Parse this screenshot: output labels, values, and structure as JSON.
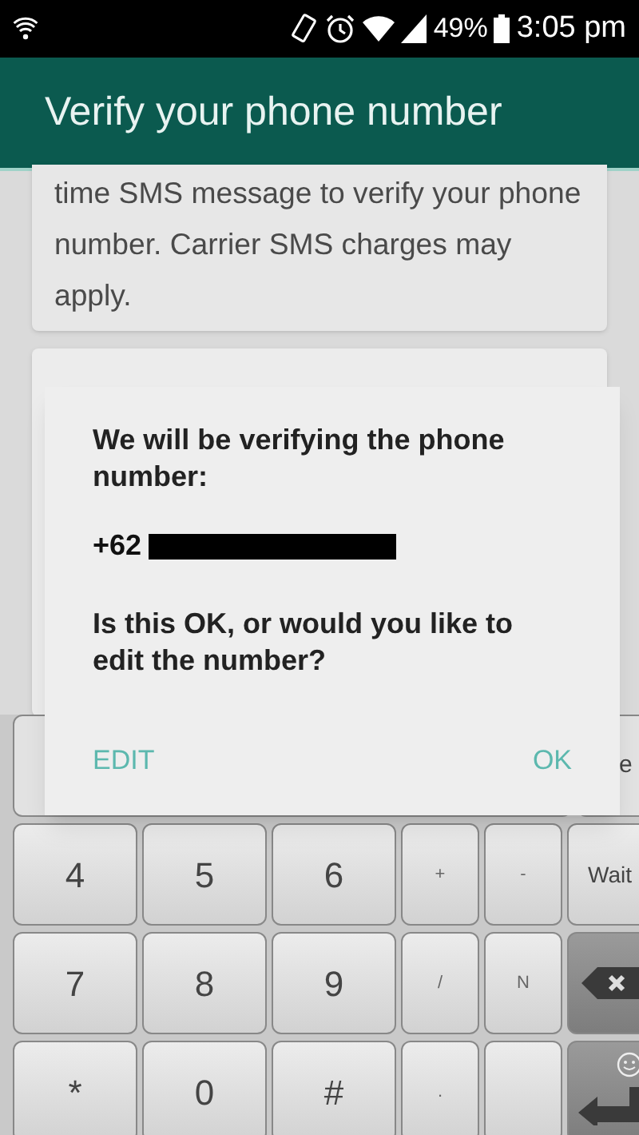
{
  "status_bar": {
    "battery_percent": "49%",
    "time": "3:05 pm"
  },
  "app_bar": {
    "title": "Verify your phone number"
  },
  "info_card": {
    "text": "time SMS message to verify your phone number. Carrier SMS charges may apply."
  },
  "dialog": {
    "message": "We will be verifying the phone number:",
    "phone_number": "+62",
    "question": "Is this OK, or would you like to edit the number?",
    "buttons": [
      {
        "label": "EDIT"
      },
      {
        "label": "OK"
      }
    ]
  },
  "keyboard": {
    "top_row_key": "e",
    "rows": [
      [
        {
          "kind": "digit",
          "label": "4"
        },
        {
          "kind": "digit",
          "label": "5"
        },
        {
          "kind": "digit",
          "label": "6"
        },
        {
          "kind": "symbol",
          "label": "+"
        },
        {
          "kind": "symbol",
          "label": "-"
        },
        {
          "kind": "word",
          "label": "Wait"
        }
      ],
      [
        {
          "kind": "digit",
          "label": "7"
        },
        {
          "kind": "digit",
          "label": "8"
        },
        {
          "kind": "digit",
          "label": "9"
        },
        {
          "kind": "symbol",
          "label": "/"
        },
        {
          "kind": "symbol",
          "label": "N"
        },
        {
          "kind": "backspace"
        }
      ],
      [
        {
          "kind": "digit",
          "label": "*"
        },
        {
          "kind": "digit",
          "label": "0"
        },
        {
          "kind": "digit",
          "label": "#"
        },
        {
          "kind": "symbol",
          "label": "."
        },
        {
          "kind": "blank"
        },
        {
          "kind": "enter"
        }
      ]
    ]
  }
}
